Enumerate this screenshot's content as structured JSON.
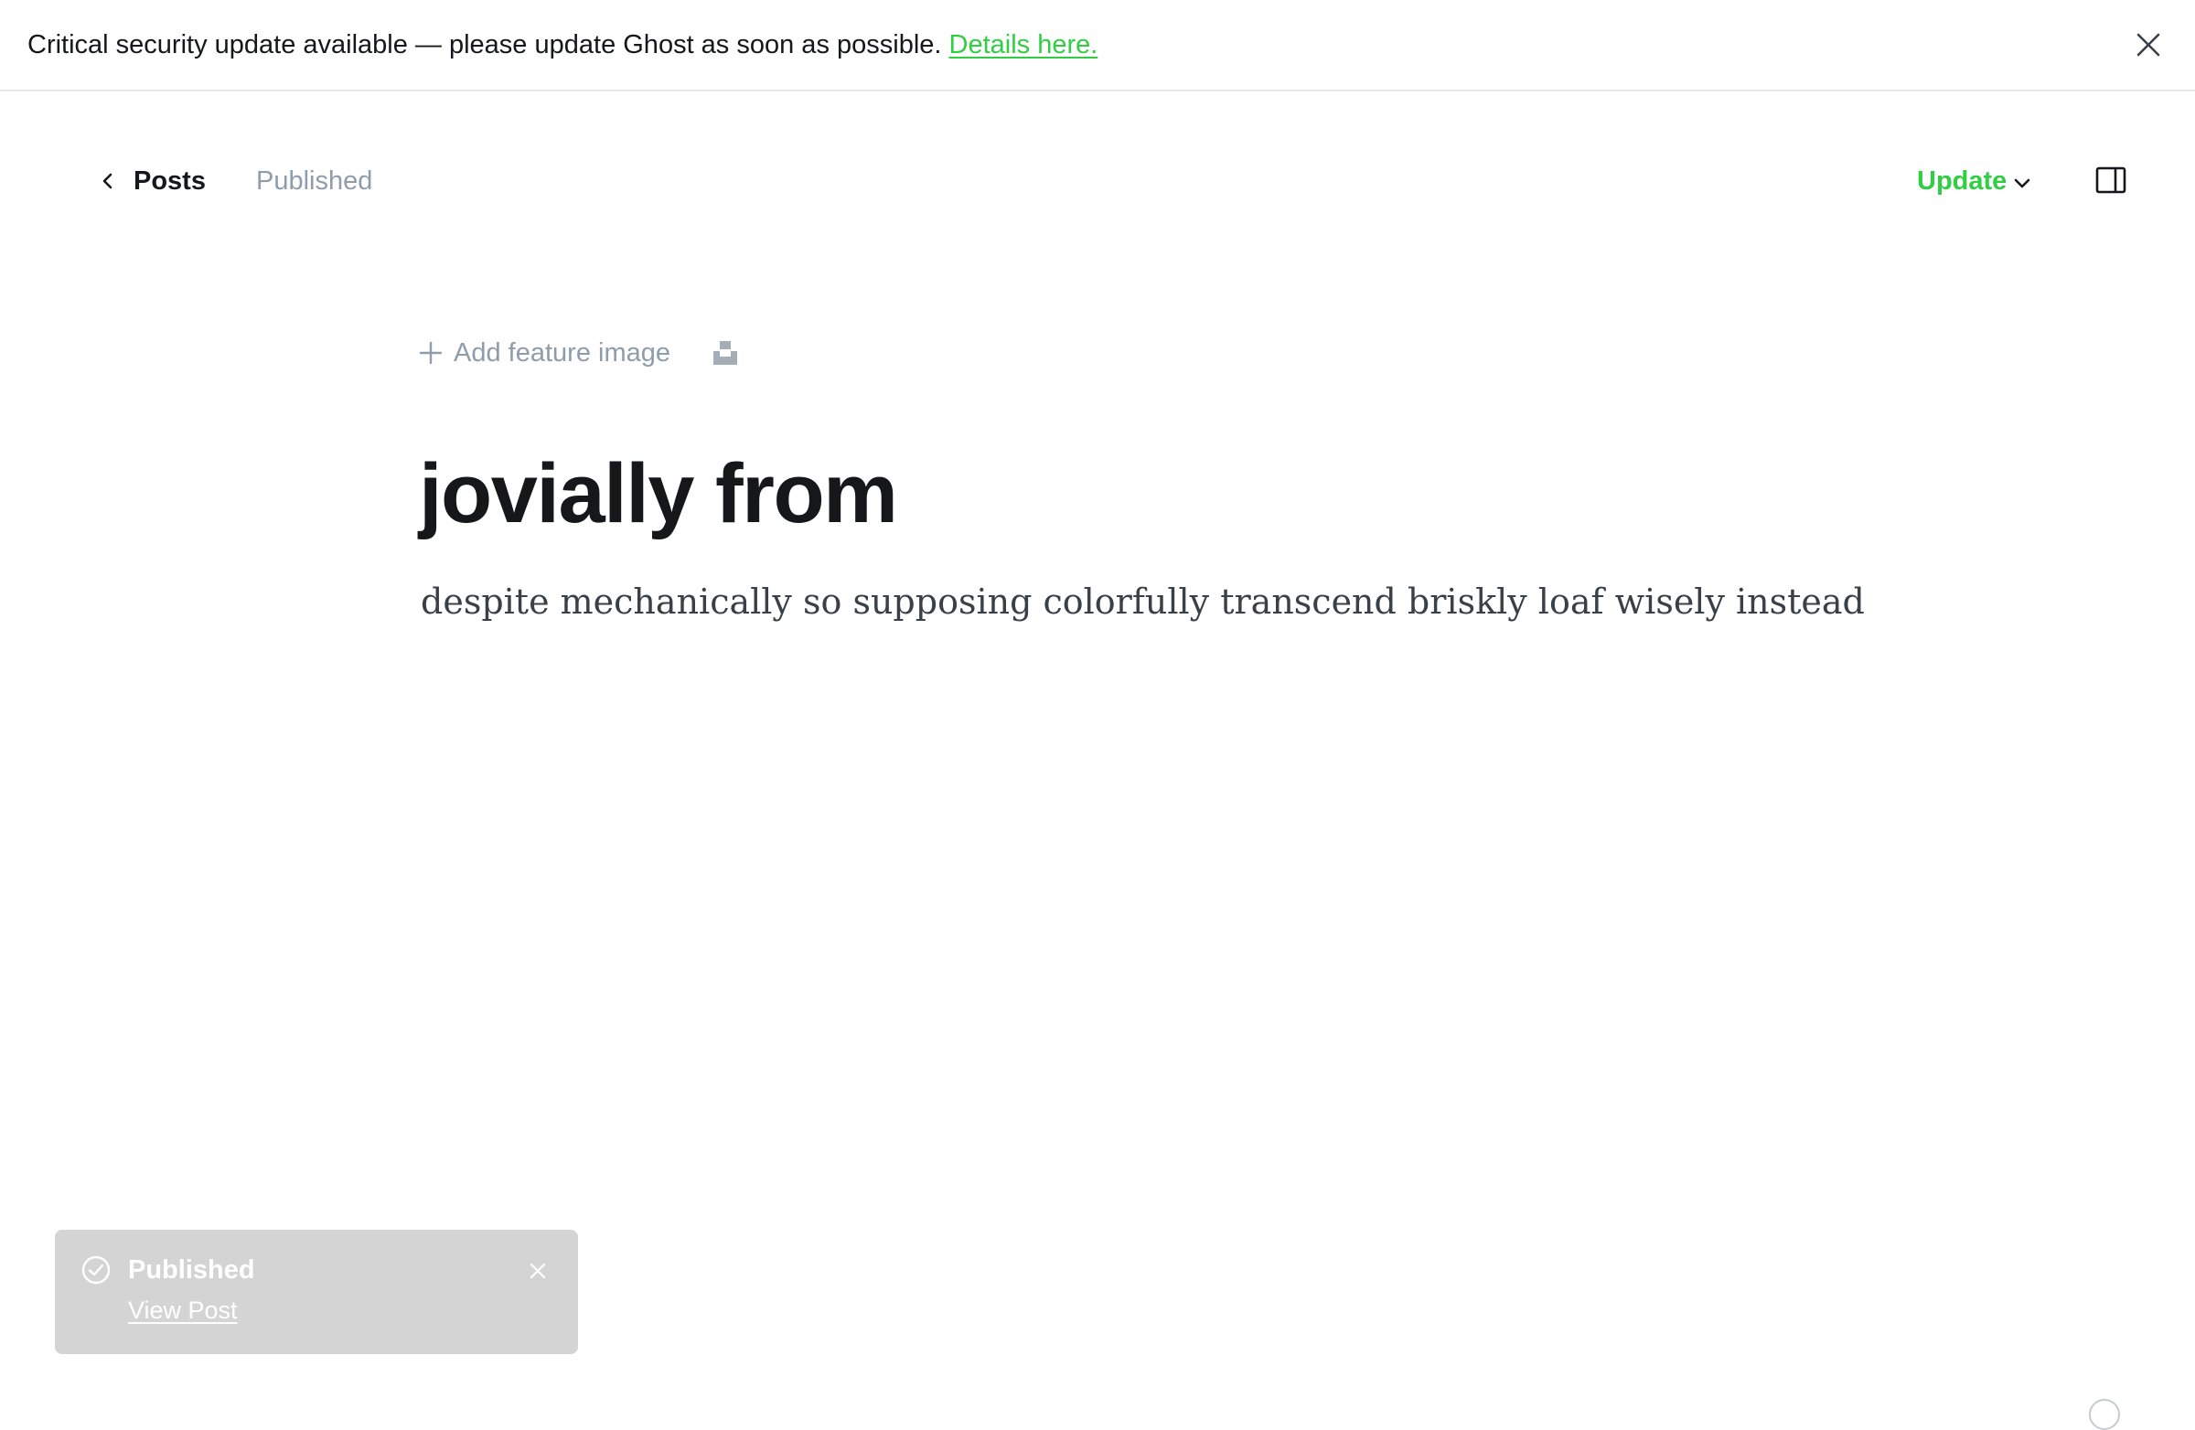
{
  "banner": {
    "message": "Critical security update available — please update Ghost as soon as possible.",
    "link_label": "Details here.",
    "close_icon": "close-icon"
  },
  "header": {
    "back_label": "Posts",
    "status": "Published",
    "update_label": "Update",
    "sidebar_icon": "sidebar-toggle-icon"
  },
  "editor": {
    "feature_image_label": "Add feature image",
    "title": "jovially from",
    "body": "despite mechanically so supposing colorfully transcend briskly loaf wisely instead"
  },
  "toast": {
    "title": "Published",
    "link_label": "View Post"
  },
  "colors": {
    "accent_green": "#30cf43",
    "muted_text": "#8e9cac",
    "toast_bg": "#d4d4d4"
  }
}
